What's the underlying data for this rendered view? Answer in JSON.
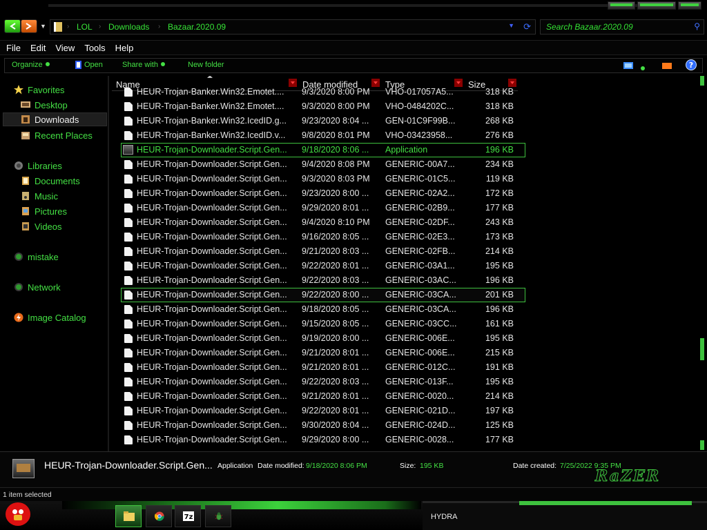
{
  "nav": {
    "breadcrumbs": [
      "LOL",
      "Downloads",
      "Bazaar.2020.09"
    ],
    "search_placeholder": "Search Bazaar.2020.09"
  },
  "menu": [
    "File",
    "Edit",
    "View",
    "Tools",
    "Help"
  ],
  "toolbar": {
    "organize": "Organize",
    "open": "Open",
    "share_with": "Share with",
    "new_folder": "New folder"
  },
  "sidebar": {
    "favorites": "Favorites",
    "desktop": "Desktop",
    "downloads": "Downloads",
    "recent_places": "Recent Places",
    "libraries": "Libraries",
    "documents": "Documents",
    "music": "Music",
    "pictures": "Pictures",
    "videos": "Videos",
    "mistake": "mistake",
    "network": "Network",
    "image_catalog": "Image Catalog"
  },
  "columns": {
    "name": "Name",
    "date": "Date modified",
    "type": "Type",
    "size": "Size"
  },
  "files": [
    {
      "name": "HEUR-Trojan-Banker.Win32.Emotet....",
      "date": "9/3/2020 8:00 PM",
      "type": "VHO-017057A5...",
      "size": "318 KB"
    },
    {
      "name": "HEUR-Trojan-Banker.Win32.Emotet....",
      "date": "9/3/2020 8:00 PM",
      "type": "VHO-0484202C...",
      "size": "318 KB"
    },
    {
      "name": "HEUR-Trojan-Banker.Win32.IcedID.g...",
      "date": "9/23/2020 8:04 ...",
      "type": "GEN-01C9F99B...",
      "size": "268 KB"
    },
    {
      "name": "HEUR-Trojan-Banker.Win32.IcedID.v...",
      "date": "9/8/2020 8:01 PM",
      "type": "VHO-03423958...",
      "size": "276 KB"
    },
    {
      "name": "HEUR-Trojan-Downloader.Script.Gen...",
      "date": "9/18/2020 8:06 ...",
      "type": "Application",
      "size": "196 KB"
    },
    {
      "name": "HEUR-Trojan-Downloader.Script.Gen...",
      "date": "9/4/2020 8:08 PM",
      "type": "GENERIC-00A7...",
      "size": "234 KB"
    },
    {
      "name": "HEUR-Trojan-Downloader.Script.Gen...",
      "date": "9/3/2020 8:03 PM",
      "type": "GENERIC-01C5...",
      "size": "119 KB"
    },
    {
      "name": "HEUR-Trojan-Downloader.Script.Gen...",
      "date": "9/23/2020 8:00 ...",
      "type": "GENERIC-02A2...",
      "size": "172 KB"
    },
    {
      "name": "HEUR-Trojan-Downloader.Script.Gen...",
      "date": "9/29/2020 8:01 ...",
      "type": "GENERIC-02B9...",
      "size": "177 KB"
    },
    {
      "name": "HEUR-Trojan-Downloader.Script.Gen...",
      "date": "9/4/2020 8:10 PM",
      "type": "GENERIC-02DF...",
      "size": "243 KB"
    },
    {
      "name": "HEUR-Trojan-Downloader.Script.Gen...",
      "date": "9/16/2020 8:05 ...",
      "type": "GENERIC-02E3...",
      "size": "173 KB"
    },
    {
      "name": "HEUR-Trojan-Downloader.Script.Gen...",
      "date": "9/21/2020 8:03 ...",
      "type": "GENERIC-02FB...",
      "size": "214 KB"
    },
    {
      "name": "HEUR-Trojan-Downloader.Script.Gen...",
      "date": "9/22/2020 8:01 ...",
      "type": "GENERIC-03A1...",
      "size": "195 KB"
    },
    {
      "name": "HEUR-Trojan-Downloader.Script.Gen...",
      "date": "9/22/2020 8:03 ...",
      "type": "GENERIC-03AC...",
      "size": "196 KB"
    },
    {
      "name": "HEUR-Trojan-Downloader.Script.Gen...",
      "date": "9/22/2020 8:00 ...",
      "type": "GENERIC-03CA...",
      "size": "201 KB"
    },
    {
      "name": "HEUR-Trojan-Downloader.Script.Gen...",
      "date": "9/18/2020 8:05 ...",
      "type": "GENERIC-03CA...",
      "size": "196 KB"
    },
    {
      "name": "HEUR-Trojan-Downloader.Script.Gen...",
      "date": "9/15/2020 8:05 ...",
      "type": "GENERIC-03CC...",
      "size": "161 KB"
    },
    {
      "name": "HEUR-Trojan-Downloader.Script.Gen...",
      "date": "9/19/2020 8:00 ...",
      "type": "GENERIC-006E...",
      "size": "195 KB"
    },
    {
      "name": "HEUR-Trojan-Downloader.Script.Gen...",
      "date": "9/21/2020 8:01 ...",
      "type": "GENERIC-006E...",
      "size": "215 KB"
    },
    {
      "name": "HEUR-Trojan-Downloader.Script.Gen...",
      "date": "9/21/2020 8:01 ...",
      "type": "GENERIC-012C...",
      "size": "191 KB"
    },
    {
      "name": "HEUR-Trojan-Downloader.Script.Gen...",
      "date": "9/22/2020 8:03 ...",
      "type": "GENERIC-013F...",
      "size": "195 KB"
    },
    {
      "name": "HEUR-Trojan-Downloader.Script.Gen...",
      "date": "9/21/2020 8:01 ...",
      "type": "GENERIC-0020...",
      "size": "214 KB"
    },
    {
      "name": "HEUR-Trojan-Downloader.Script.Gen...",
      "date": "9/22/2020 8:01 ...",
      "type": "GENERIC-021D...",
      "size": "197 KB"
    },
    {
      "name": "HEUR-Trojan-Downloader.Script.Gen...",
      "date": "9/30/2020 8:04 ...",
      "type": "GENERIC-024D...",
      "size": "125 KB"
    },
    {
      "name": "HEUR-Trojan-Downloader.Script.Gen...",
      "date": "9/29/2020 8:00 ...",
      "type": "GENERIC-0028...",
      "size": "177 KB"
    }
  ],
  "details": {
    "name": "HEUR-Trojan-Downloader.Script.Gen...",
    "type": "Application",
    "date_modified_label": "Date modified:",
    "date_modified": "9/18/2020 8:06 PM",
    "size_label": "Size:",
    "size": "195 KB",
    "date_created_label": "Date created:",
    "date_created": "7/25/2022 9:35 PM"
  },
  "status": "1 item selected",
  "taskbar": {
    "hydra": "HYDRA",
    "icons": [
      "folder-icon",
      "chrome-icon",
      "7zip-icon",
      "bug-icon"
    ]
  },
  "colors": {
    "accent": "#3ec13e",
    "background": "#000000",
    "header_arrow": "#8a0000"
  }
}
